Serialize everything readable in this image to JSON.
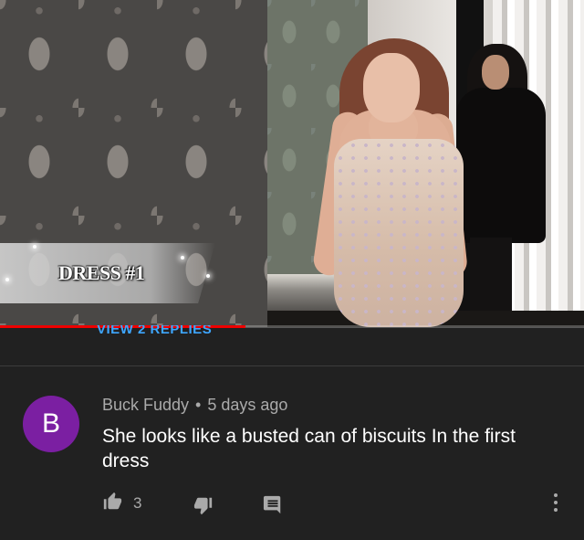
{
  "video": {
    "overlay_title": "DRESS #1",
    "progress_fraction": 0.42
  },
  "thread": {
    "view_replies_label": "VIEW 2 REPLIES"
  },
  "comment": {
    "avatar_letter": "B",
    "avatar_color": "#7b1fa2",
    "author": "Buck Fuddy",
    "separator": "•",
    "timestamp": "5 days ago",
    "text": "She looks like a busted can of biscuits In the first dress",
    "like_count": "3"
  },
  "icons": {
    "like": "thumbs-up-icon",
    "dislike": "thumbs-down-icon",
    "reply": "comment-icon",
    "more": "more-vert-icon"
  },
  "colors": {
    "background": "#212121",
    "progress": "#ee0000",
    "link": "#3ea6ff",
    "secondary_text": "#aaaaaa"
  }
}
